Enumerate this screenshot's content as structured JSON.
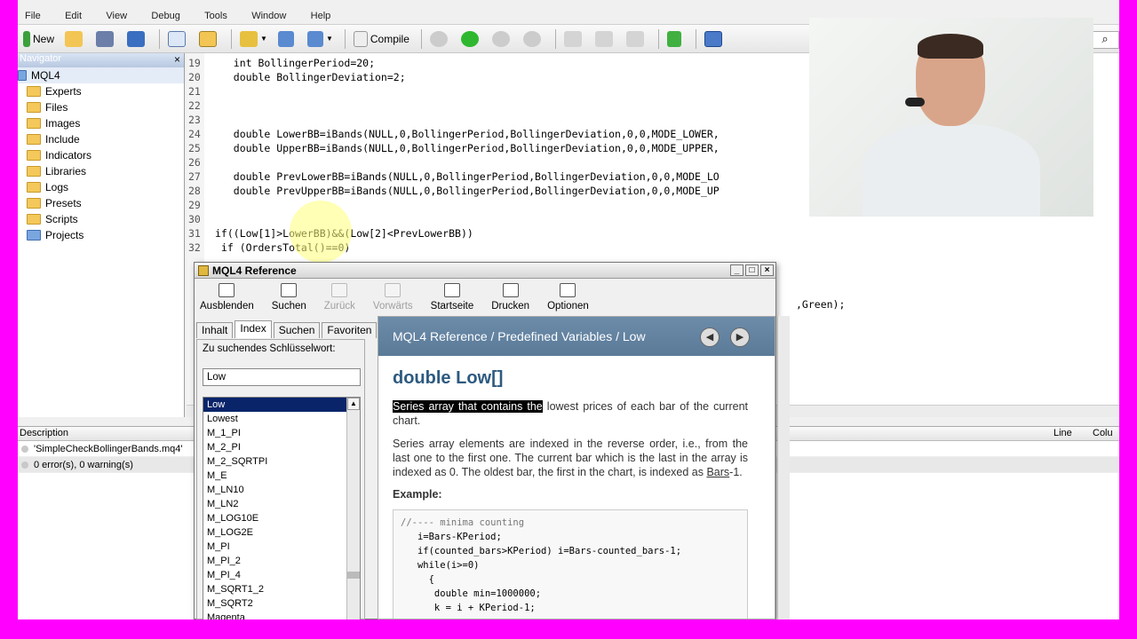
{
  "menubar": [
    "File",
    "Edit",
    "View",
    "Debug",
    "Tools",
    "Window",
    "Help"
  ],
  "toolbar": {
    "new_label": "New",
    "compile_label": "Compile"
  },
  "search_icon": "search-icon",
  "navigator": {
    "title": "Navigator",
    "root": "MQL4",
    "items": [
      "Experts",
      "Files",
      "Images",
      "Include",
      "Indicators",
      "Libraries",
      "Logs",
      "Presets",
      "Scripts",
      "Projects"
    ]
  },
  "editor": {
    "lines": [
      {
        "n": "19",
        "text": "   int BollingerPeriod=20;"
      },
      {
        "n": "20",
        "text": "   double BollingerDeviation=2;"
      },
      {
        "n": "21",
        "text": ""
      },
      {
        "n": "22",
        "text": ""
      },
      {
        "n": "23",
        "text": ""
      },
      {
        "n": "24",
        "text": "   double LowerBB=iBands(NULL,0,BollingerPeriod,BollingerDeviation,0,0,MODE_LOWER,"
      },
      {
        "n": "25",
        "text": "   double UpperBB=iBands(NULL,0,BollingerPeriod,BollingerDeviation,0,0,MODE_UPPER,"
      },
      {
        "n": "26",
        "text": ""
      },
      {
        "n": "27",
        "text": "   double PrevLowerBB=iBands(NULL,0,BollingerPeriod,BollingerDeviation,0,0,MODE_LO"
      },
      {
        "n": "28",
        "text": "   double PrevUpperBB=iBands(NULL,0,BollingerPeriod,BollingerDeviation,0,0,MODE_UP"
      },
      {
        "n": "29",
        "text": ""
      },
      {
        "n": "30",
        "text": ""
      },
      {
        "n": "31",
        "text": "if((Low[1]>LowerBB)&&(Low[2]<PrevLowerBB))"
      },
      {
        "n": "32",
        "text": " if (OrdersTotal()==0)"
      }
    ],
    "trailing_fragment": ",Green);"
  },
  "description_panel": {
    "col_description": "Description",
    "col_line": "Line",
    "col_column": "Colu",
    "rows": [
      "'SimpleCheckBollingerBands.mq4'",
      "0 error(s), 0 warning(s)"
    ]
  },
  "help": {
    "title": "MQL4 Reference",
    "toolbar": [
      "Ausblenden",
      "Suchen",
      "Zurück",
      "Vorwärts",
      "Startseite",
      "Drucken",
      "Optionen"
    ],
    "tabs": [
      "Inhalt",
      "Index",
      "Suchen",
      "Favoriten"
    ],
    "keyword_label": "Zu suchendes Schlüsselwort:",
    "keyword_value": "Low",
    "index_items": [
      "Low",
      "Lowest",
      "M_1_PI",
      "M_2_PI",
      "M_2_SQRTPI",
      "M_E",
      "M_LN10",
      "M_LN2",
      "M_LOG10E",
      "M_LOG2E",
      "M_PI",
      "M_PI_2",
      "M_PI_4",
      "M_SQRT1_2",
      "M_SQRT2",
      "Magenta"
    ],
    "breadcrumb": "MQL4 Reference / Predefined Variables / Low",
    "heading": "double Low[]",
    "para1_highlight": "Series array that contains the",
    "para1_rest": "lowest prices of each bar of the current chart.",
    "para2_a": "Series array elements are indexed in the reverse order, i.e., from the last one to the first one. The current bar which is the last in the array is indexed as 0. The oldest bar, the first in the chart, is indexed as",
    "para2_link": "Bars",
    "para2_b": "-1.",
    "example_label": "Example:",
    "code": [
      "//---- minima counting",
      "   i=Bars-KPeriod;",
      "   if(counted_bars>KPeriod) i=Bars-counted_bars-1;",
      "   while(i>=0)",
      "     {",
      "      double min=1000000;",
      "      k = i + KPeriod-1;"
    ]
  }
}
